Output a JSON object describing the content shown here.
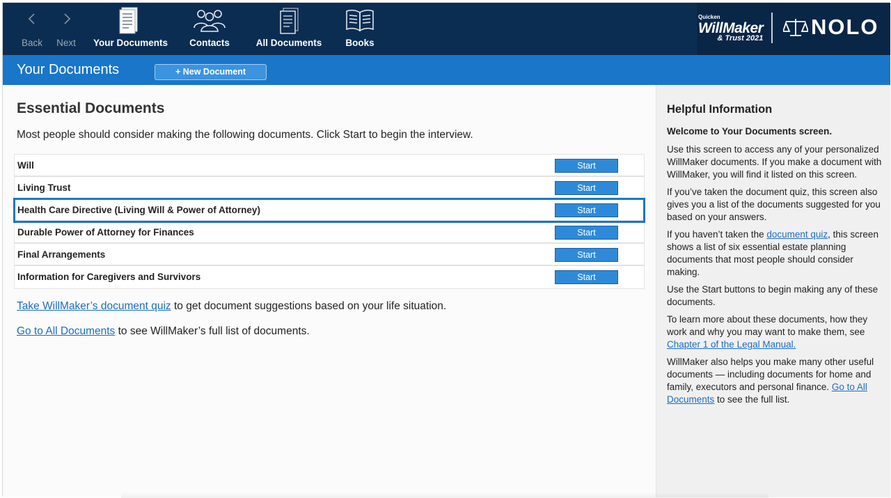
{
  "toolbar": {
    "back": "Back",
    "next": "Next",
    "your_documents": "Your Documents",
    "contacts": "Contacts",
    "all_documents": "All Documents",
    "books": "Books"
  },
  "brand": {
    "quicken": "Quicken",
    "willmaker": "WillMaker",
    "trust": "& Trust 2021",
    "nolo": "NOLO"
  },
  "header": {
    "title": "Your Documents",
    "new_document": "+ New Document"
  },
  "main": {
    "heading": "Essential Documents",
    "intro": "Most people should consider making the following documents. Click Start to begin the interview.",
    "documents": [
      {
        "name": "Will",
        "action": "Start"
      },
      {
        "name": "Living Trust",
        "action": "Start"
      },
      {
        "name": "Health Care Directive (Living Will & Power of Attorney)",
        "action": "Start"
      },
      {
        "name": "Durable Power of Attorney for Finances",
        "action": "Start"
      },
      {
        "name": "Final Arrangements",
        "action": "Start"
      },
      {
        "name": "Information for Caregivers and Survivors",
        "action": "Start"
      }
    ],
    "quiz_link": "Take WillMaker’s document quiz",
    "quiz_text": " to get document suggestions based on your life situation.",
    "all_docs_link": "Go to All Documents",
    "all_docs_text": " to see WillMaker’s full list of documents."
  },
  "side": {
    "heading": "Helpful Information",
    "welcome": "Welcome to Your Documents screen.",
    "p1": "Use this screen to access any of your personalized WillMaker documents. If you make a document with WillMaker, you will find it listed on this screen.",
    "p2": "If you’ve taken the document quiz, this screen also gives you a list of the documents suggested for you based on your answers.",
    "p3_a": "If you haven’t taken the ",
    "p3_link": "document quiz",
    "p3_b": ", this screen shows a list of six essential estate planning documents that most people should consider making.",
    "p4": "Use the Start buttons to begin making any of these documents.",
    "p5_a": "To learn more about these documents, how they work and why you may want to make them, see ",
    "p5_link": "Chapter 1 of the Legal Manual.",
    "p6_a": "WillMaker also helps you make many other useful documents — including documents for home and family, executors and personal finance. ",
    "p6_link": "Go to All Documents",
    "p6_b": " to see the full list."
  },
  "colors": {
    "toolbar_bg": "#0c2d52",
    "header_bg": "#1a76c9",
    "button_bg": "#2e8ad9",
    "link": "#1a6dc4"
  }
}
